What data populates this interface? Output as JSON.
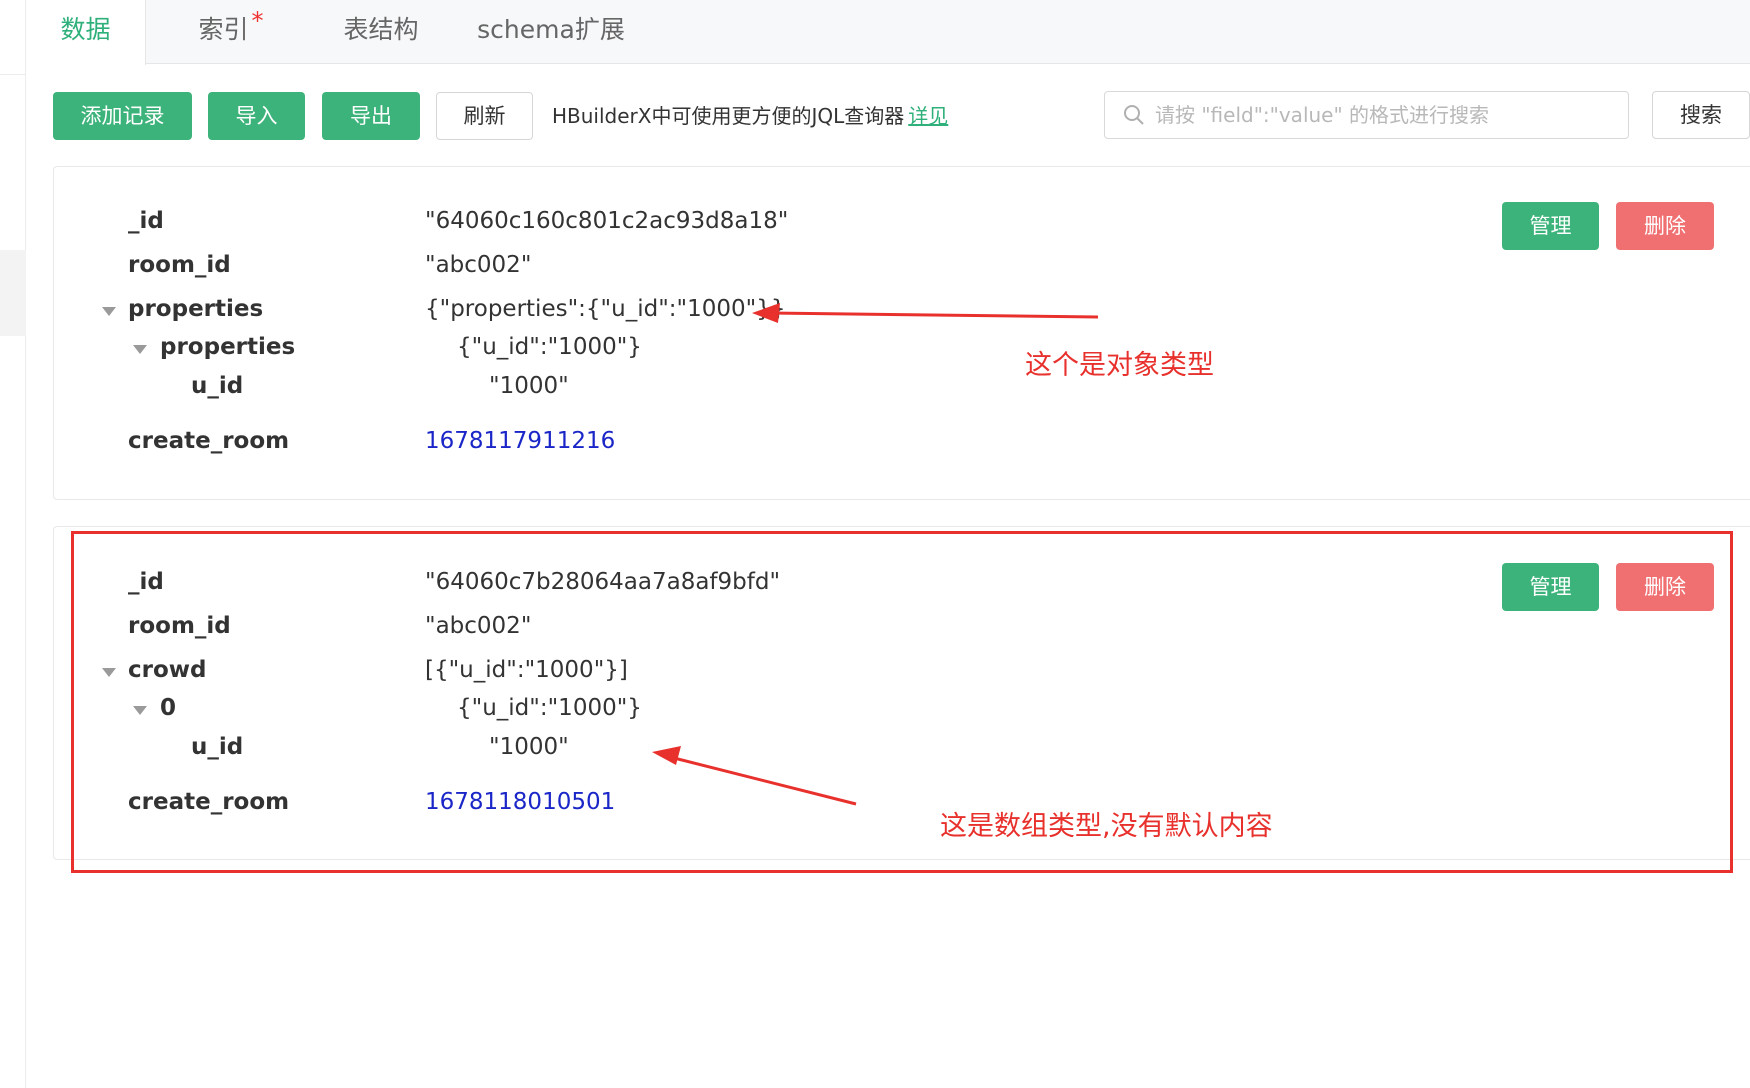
{
  "tabs": [
    {
      "label": "数据",
      "active": true
    },
    {
      "label": "索引",
      "required_mark": "*"
    },
    {
      "label": "表结构"
    },
    {
      "label": "schema扩展"
    }
  ],
  "toolbar": {
    "add_record": "添加记录",
    "import": "导入",
    "export": "导出",
    "refresh": "刷新",
    "hint": "HBuilderX中可使用更方便的JQL查询器",
    "hint_link": "详见",
    "search_placeholder": "请按 \"field\":\"value\" 的格式进行搜索",
    "search_button": "搜索"
  },
  "records": [
    {
      "manage": "管理",
      "delete": "删除",
      "fields": [
        {
          "key": "_id",
          "value": "\"64060c160c801c2ac93d8a18\""
        },
        {
          "key": "room_id",
          "value": "\"abc002\""
        },
        {
          "key": "properties",
          "value": "{\"properties\":{\"u_id\":\"1000\"}}"
        },
        {
          "key": "properties",
          "value": "{\"u_id\":\"1000\"}"
        },
        {
          "key": "u_id",
          "value": "\"1000\""
        },
        {
          "key": "create_room",
          "value": "1678117911216"
        }
      ]
    },
    {
      "manage": "管理",
      "delete": "删除",
      "fields": [
        {
          "key": "_id",
          "value": "\"64060c7b28064aa7a8af9bfd\""
        },
        {
          "key": "room_id",
          "value": "\"abc002\""
        },
        {
          "key": "crowd",
          "value": "[{\"u_id\":\"1000\"}]"
        },
        {
          "key": "0",
          "value": "{\"u_id\":\"1000\"}"
        },
        {
          "key": "u_id",
          "value": "\"1000\""
        },
        {
          "key": "create_room",
          "value": "1678118010501"
        }
      ]
    }
  ],
  "annotations": {
    "object_note": "这个是对象类型",
    "array_note": "这是数组类型,没有默认内容",
    "color": "#e8312c"
  },
  "colors": {
    "accent": "#3cb37a",
    "danger": "#f07072",
    "number": "#1a26c7"
  }
}
